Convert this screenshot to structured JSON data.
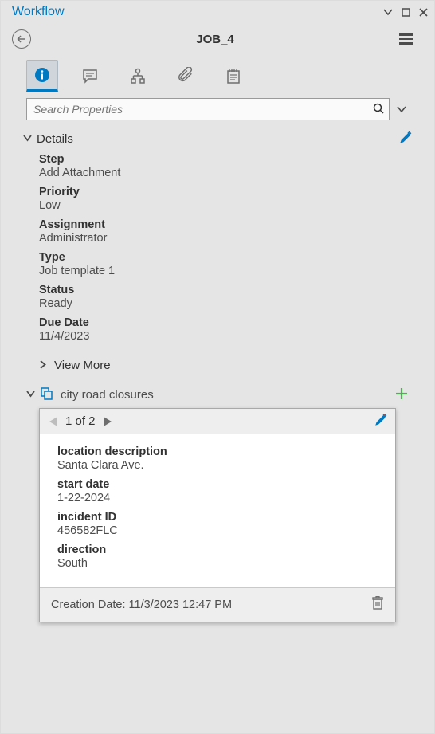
{
  "panel": {
    "title": "Workflow"
  },
  "job": {
    "title": "JOB_4"
  },
  "search": {
    "placeholder": "Search Properties"
  },
  "details": {
    "header": "Details",
    "fields": {
      "step": {
        "label": "Step",
        "value": "Add Attachment"
      },
      "priority": {
        "label": "Priority",
        "value": "Low"
      },
      "assignment": {
        "label": "Assignment",
        "value": "Administrator"
      },
      "type": {
        "label": "Type",
        "value": "Job template 1"
      },
      "status": {
        "label": "Status",
        "value": "Ready"
      },
      "dueDate": {
        "label": "Due Date",
        "value": "11/4/2023"
      }
    },
    "viewMore": "View More"
  },
  "related": {
    "title": "city road closures",
    "pager": "1 of 2",
    "fields": {
      "location": {
        "label": "location description",
        "value": "Santa Clara Ave."
      },
      "startDate": {
        "label": "start date",
        "value": "1-22-2024"
      },
      "incident": {
        "label": "incident ID",
        "value": "456582FLC"
      },
      "direction": {
        "label": "direction",
        "value": "South"
      }
    },
    "creation": "Creation Date: 11/3/2023 12:47 PM"
  }
}
